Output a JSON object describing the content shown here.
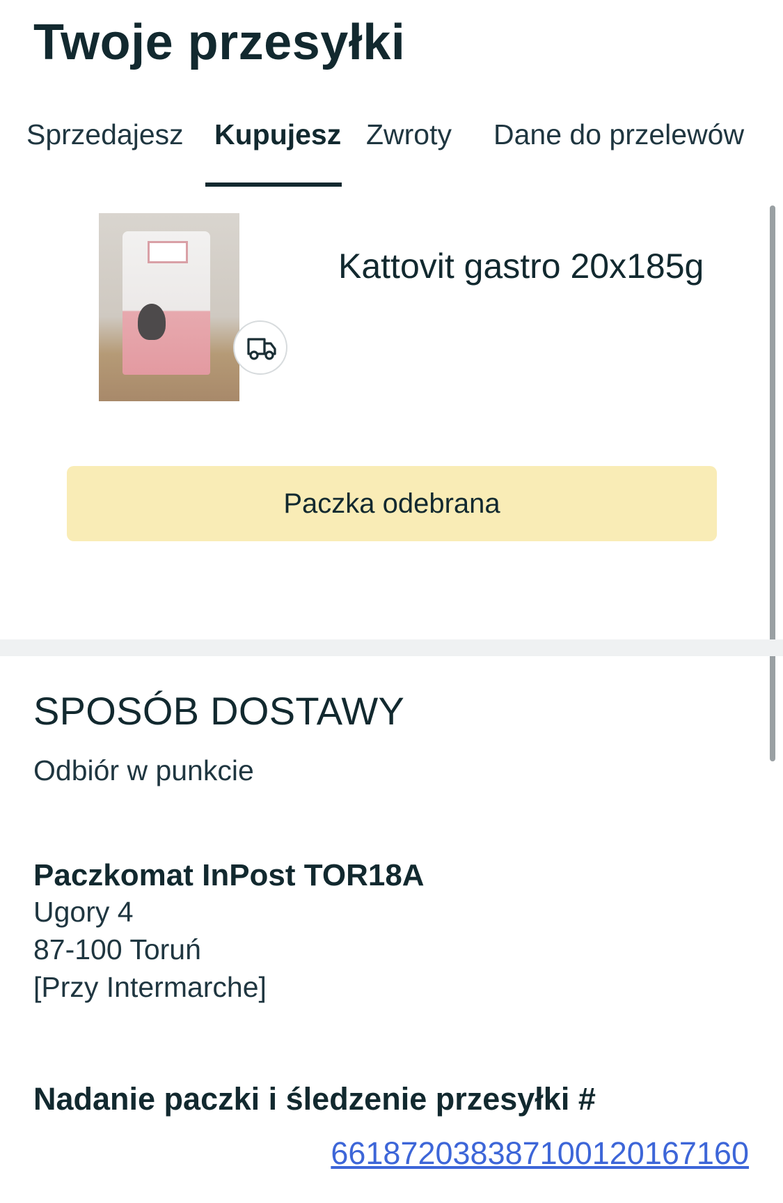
{
  "header": {
    "title": "Twoje przesyłki"
  },
  "tabs": [
    {
      "label": "Sprzedajesz",
      "active": false
    },
    {
      "label": "Kupujesz",
      "active": true
    },
    {
      "label": "Zwroty",
      "active": false
    },
    {
      "label": "Dane do przelewów",
      "active": false
    }
  ],
  "product": {
    "title": "Kattovit gastro 20x185g",
    "badge_icon": "truck-icon"
  },
  "status": {
    "label": "Paczka odebrana",
    "color": "#f9ecb6"
  },
  "delivery": {
    "heading": "SPOSÓB DOSTAWY",
    "method": "Odbiór w punkcie",
    "locker_name": "Paczkomat InPost TOR18A",
    "address": [
      "Ugory 4",
      "87-100 Toruń",
      "[Przy Intermarche]"
    ]
  },
  "tracking": {
    "heading": "Nadanie paczki i śledzenie przesyłki #",
    "number": "661872038387100120167160",
    "link_color": "#3d66d8"
  }
}
